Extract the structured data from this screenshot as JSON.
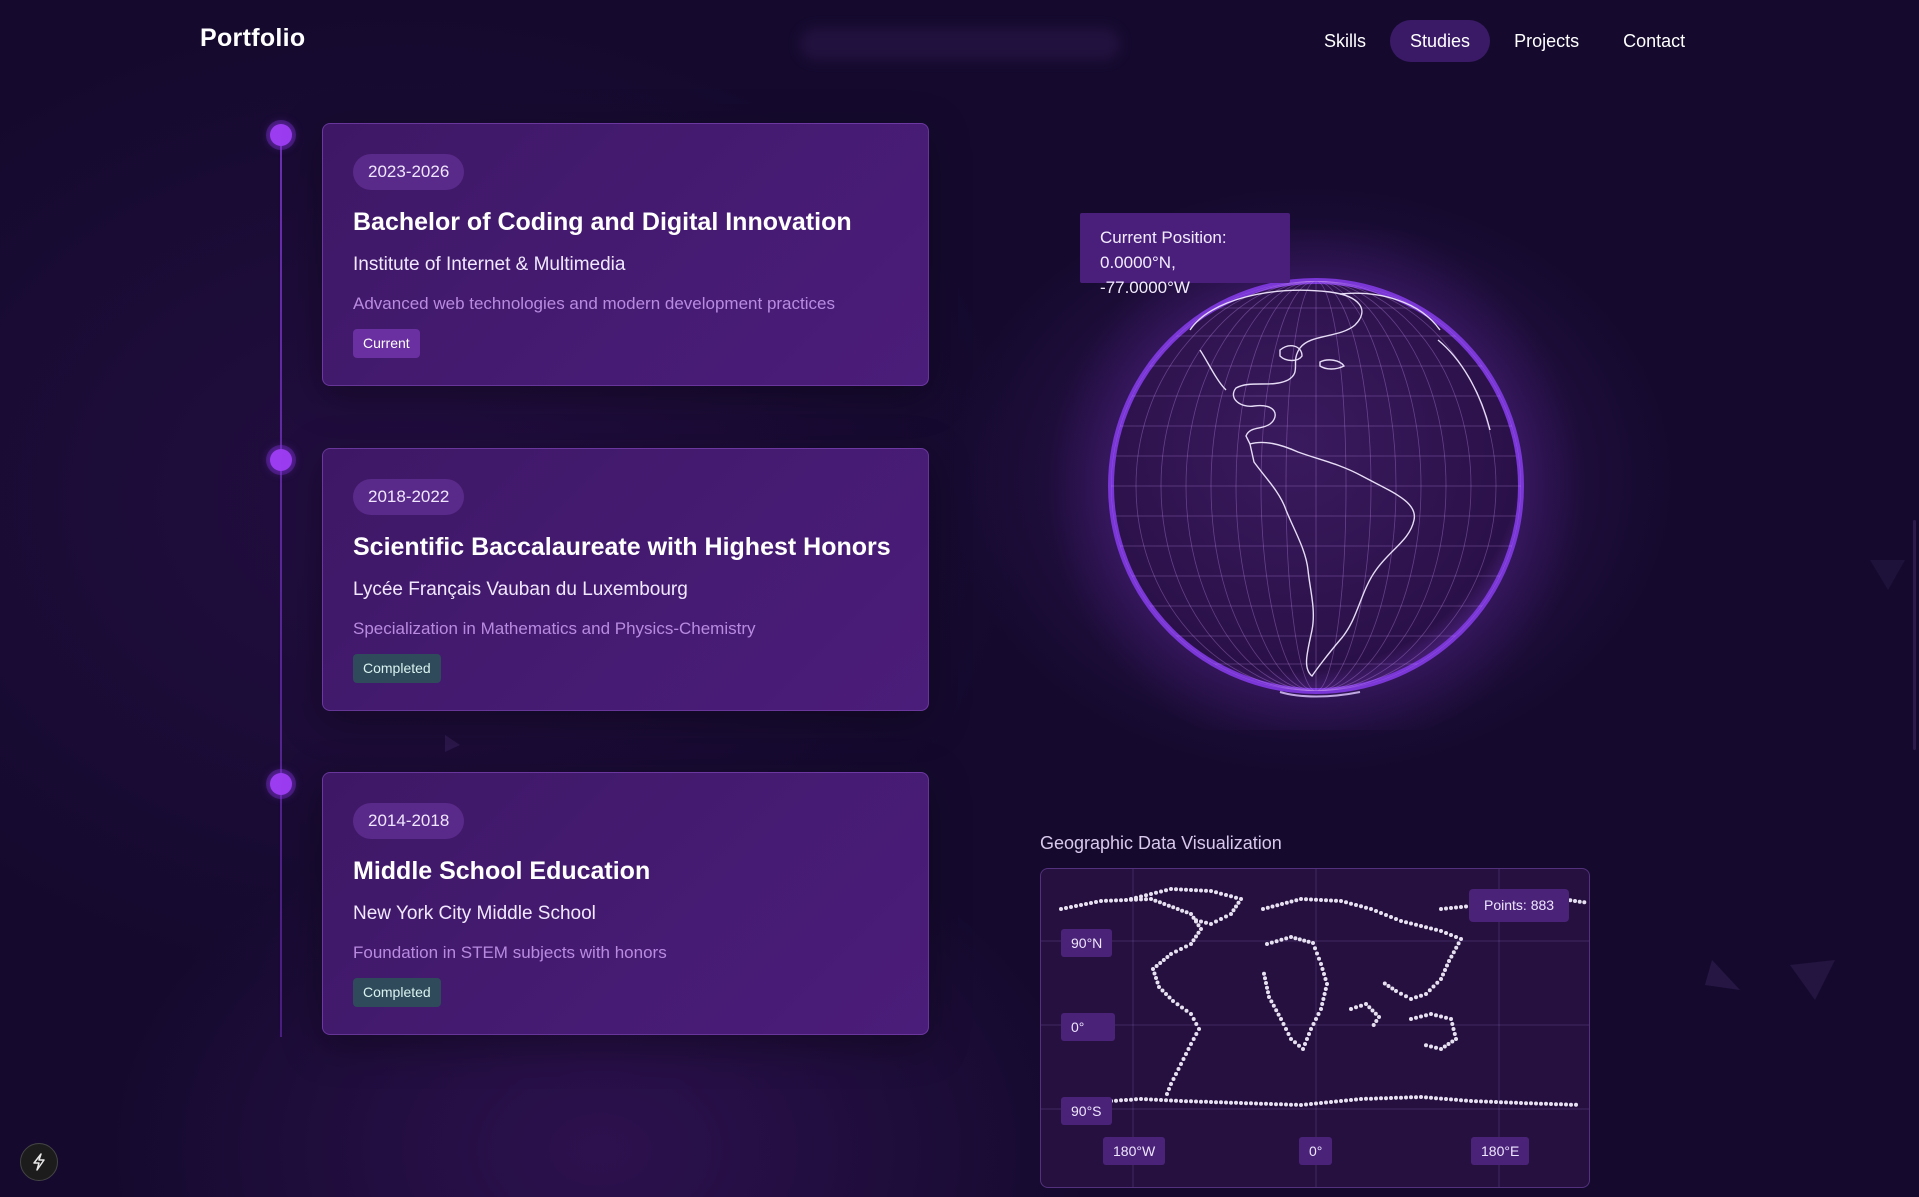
{
  "header": {
    "logo": "Portfolio",
    "nav": [
      {
        "label": "Skills",
        "active": false
      },
      {
        "label": "Studies",
        "active": true
      },
      {
        "label": "Projects",
        "active": false
      },
      {
        "label": "Contact",
        "active": false
      }
    ]
  },
  "studies": [
    {
      "years": "2023-2026",
      "degree": "Bachelor of Coding and Digital Innovation",
      "school": "Institute of Internet & Multimedia",
      "description": "Advanced web technologies and modern development practices",
      "status": "Current"
    },
    {
      "years": "2018-2022",
      "degree": "Scientific Baccalaureate with Highest Honors",
      "school": "Lycée Français Vauban du Luxembourg",
      "description": "Specialization in Mathematics and Physics-Chemistry",
      "status": "Completed"
    },
    {
      "years": "2014-2018",
      "degree": "Middle School Education",
      "school": "New York City Middle School",
      "description": "Foundation in STEM subjects with honors",
      "status": "Completed"
    }
  ],
  "globe": {
    "label": "Current Position:",
    "coords": "0.0000°N, -77.0000°W"
  },
  "geo_viz": {
    "title": "Geographic Data Visualization",
    "points_label": "Points: 883",
    "lat_labels": [
      "90°N",
      "0°",
      "90°S"
    ],
    "lon_labels": [
      "180°W",
      "0°",
      "180°E"
    ]
  },
  "colors": {
    "background": "#150a2e",
    "card": "#421a6e",
    "accent": "#9b3cf0",
    "current_badge": "#6a2fa0",
    "completed_badge": "#2f4a5a"
  },
  "icons": {
    "corner_button": "lightning-bolt-icon"
  }
}
